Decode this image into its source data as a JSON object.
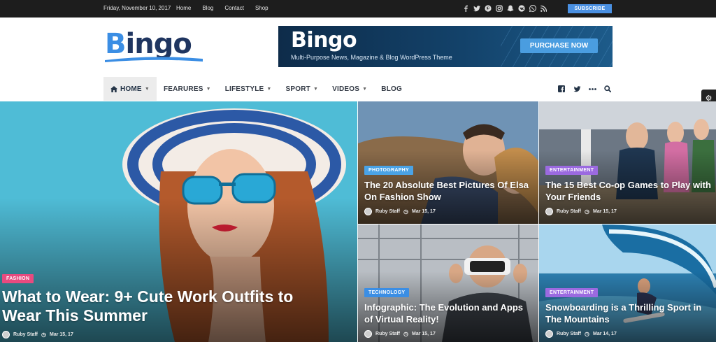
{
  "topbar": {
    "date": "Friday, November 10, 2017",
    "links": [
      "Home",
      "Blog",
      "Contact",
      "Shop"
    ],
    "social_icons": [
      "facebook-icon",
      "twitter-icon",
      "pinterest-icon",
      "instagram-icon",
      "snapchat-icon",
      "vk-icon",
      "whatsapp-icon",
      "rss-icon"
    ],
    "subscribe_label": "SUBSCRIBE"
  },
  "logo": {
    "text_first": "B",
    "text_rest": "ingo"
  },
  "banner": {
    "title": "Bingo",
    "subtitle": "Multi-Purpose News, Magazine & Blog WordPress Theme",
    "button_label": "PURCHASE NOW"
  },
  "nav": {
    "items": [
      {
        "label": "HOME",
        "has_dropdown": true,
        "active": true
      },
      {
        "label": "FEARURES",
        "has_dropdown": true
      },
      {
        "label": "LIFESTYLE",
        "has_dropdown": true
      },
      {
        "label": "SPORT",
        "has_dropdown": true
      },
      {
        "label": "VIDEOS",
        "has_dropdown": true
      },
      {
        "label": "BLOG",
        "has_dropdown": false
      }
    ],
    "right_icons": [
      "facebook-icon",
      "twitter-icon",
      "more-icon",
      "search-icon"
    ]
  },
  "side_widgets": [
    "gear-icon",
    "cart-icon"
  ],
  "posts": [
    {
      "category": "FASHION",
      "title": "What to Wear: 9+ Cute Work Outfits to Wear This Summer",
      "author": "Ruby Staff",
      "date": "Mar 15, 17",
      "category_color": "#e84a7f"
    },
    {
      "category": "PHOTOGRAPHY",
      "title": "The 20 Absolute Best Pictures Of Elsa On Fashion Show",
      "author": "Ruby Staff",
      "date": "Mar 15, 17",
      "category_color": "#4aa3e6"
    },
    {
      "category": "ENTERTAINMENT",
      "title": "The 15 Best Co-op Games to Play with Your Friends",
      "author": "Ruby Staff",
      "date": "Mar 15, 17",
      "category_color": "#9b6ae0"
    },
    {
      "category": "TECHNOLOGY",
      "title": "Infographic: The Evolution and Apps of Virtual Reality!",
      "author": "Ruby Staff",
      "date": "Mar 15, 17",
      "category_color": "#3b8ee4"
    },
    {
      "category": "ENTERTAINMENT",
      "title": "Snowboarding is a Thrilling Sport in The Mountains",
      "author": "Ruby Staff",
      "date": "Mar 14, 17",
      "category_color": "#9b6ae0"
    }
  ],
  "colors": {
    "accent": "#4a90e2",
    "topbar_bg": "#1d1d1d",
    "nav_text": "#333a45"
  }
}
